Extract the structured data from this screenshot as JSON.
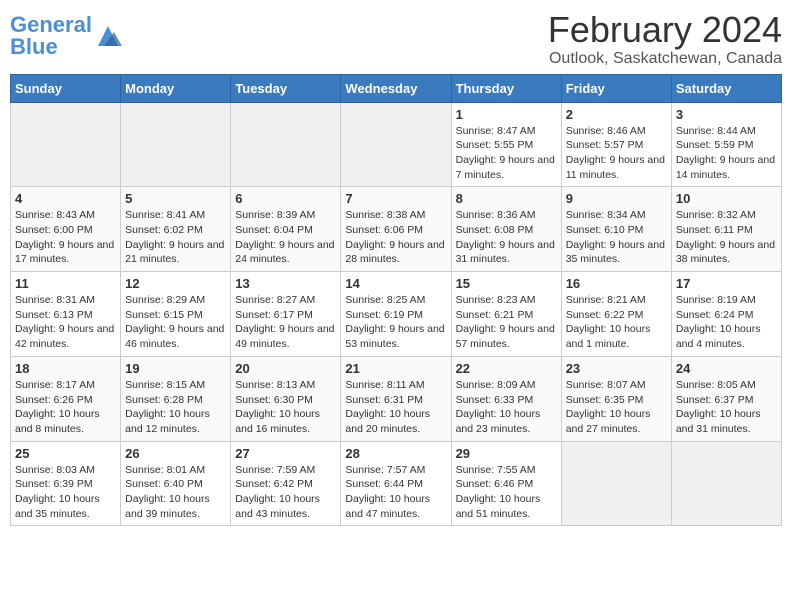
{
  "header": {
    "logo_general": "General",
    "logo_blue": "Blue",
    "title": "February 2024",
    "subtitle": "Outlook, Saskatchewan, Canada"
  },
  "weekdays": [
    "Sunday",
    "Monday",
    "Tuesday",
    "Wednesday",
    "Thursday",
    "Friday",
    "Saturday"
  ],
  "weeks": [
    [
      {
        "day": "",
        "info": ""
      },
      {
        "day": "",
        "info": ""
      },
      {
        "day": "",
        "info": ""
      },
      {
        "day": "",
        "info": ""
      },
      {
        "day": "1",
        "info": "Sunrise: 8:47 AM\nSunset: 5:55 PM\nDaylight: 9 hours and 7 minutes."
      },
      {
        "day": "2",
        "info": "Sunrise: 8:46 AM\nSunset: 5:57 PM\nDaylight: 9 hours and 11 minutes."
      },
      {
        "day": "3",
        "info": "Sunrise: 8:44 AM\nSunset: 5:59 PM\nDaylight: 9 hours and 14 minutes."
      }
    ],
    [
      {
        "day": "4",
        "info": "Sunrise: 8:43 AM\nSunset: 6:00 PM\nDaylight: 9 hours and 17 minutes."
      },
      {
        "day": "5",
        "info": "Sunrise: 8:41 AM\nSunset: 6:02 PM\nDaylight: 9 hours and 21 minutes."
      },
      {
        "day": "6",
        "info": "Sunrise: 8:39 AM\nSunset: 6:04 PM\nDaylight: 9 hours and 24 minutes."
      },
      {
        "day": "7",
        "info": "Sunrise: 8:38 AM\nSunset: 6:06 PM\nDaylight: 9 hours and 28 minutes."
      },
      {
        "day": "8",
        "info": "Sunrise: 8:36 AM\nSunset: 6:08 PM\nDaylight: 9 hours and 31 minutes."
      },
      {
        "day": "9",
        "info": "Sunrise: 8:34 AM\nSunset: 6:10 PM\nDaylight: 9 hours and 35 minutes."
      },
      {
        "day": "10",
        "info": "Sunrise: 8:32 AM\nSunset: 6:11 PM\nDaylight: 9 hours and 38 minutes."
      }
    ],
    [
      {
        "day": "11",
        "info": "Sunrise: 8:31 AM\nSunset: 6:13 PM\nDaylight: 9 hours and 42 minutes."
      },
      {
        "day": "12",
        "info": "Sunrise: 8:29 AM\nSunset: 6:15 PM\nDaylight: 9 hours and 46 minutes."
      },
      {
        "day": "13",
        "info": "Sunrise: 8:27 AM\nSunset: 6:17 PM\nDaylight: 9 hours and 49 minutes."
      },
      {
        "day": "14",
        "info": "Sunrise: 8:25 AM\nSunset: 6:19 PM\nDaylight: 9 hours and 53 minutes."
      },
      {
        "day": "15",
        "info": "Sunrise: 8:23 AM\nSunset: 6:21 PM\nDaylight: 9 hours and 57 minutes."
      },
      {
        "day": "16",
        "info": "Sunrise: 8:21 AM\nSunset: 6:22 PM\nDaylight: 10 hours and 1 minute."
      },
      {
        "day": "17",
        "info": "Sunrise: 8:19 AM\nSunset: 6:24 PM\nDaylight: 10 hours and 4 minutes."
      }
    ],
    [
      {
        "day": "18",
        "info": "Sunrise: 8:17 AM\nSunset: 6:26 PM\nDaylight: 10 hours and 8 minutes."
      },
      {
        "day": "19",
        "info": "Sunrise: 8:15 AM\nSunset: 6:28 PM\nDaylight: 10 hours and 12 minutes."
      },
      {
        "day": "20",
        "info": "Sunrise: 8:13 AM\nSunset: 6:30 PM\nDaylight: 10 hours and 16 minutes."
      },
      {
        "day": "21",
        "info": "Sunrise: 8:11 AM\nSunset: 6:31 PM\nDaylight: 10 hours and 20 minutes."
      },
      {
        "day": "22",
        "info": "Sunrise: 8:09 AM\nSunset: 6:33 PM\nDaylight: 10 hours and 23 minutes."
      },
      {
        "day": "23",
        "info": "Sunrise: 8:07 AM\nSunset: 6:35 PM\nDaylight: 10 hours and 27 minutes."
      },
      {
        "day": "24",
        "info": "Sunrise: 8:05 AM\nSunset: 6:37 PM\nDaylight: 10 hours and 31 minutes."
      }
    ],
    [
      {
        "day": "25",
        "info": "Sunrise: 8:03 AM\nSunset: 6:39 PM\nDaylight: 10 hours and 35 minutes."
      },
      {
        "day": "26",
        "info": "Sunrise: 8:01 AM\nSunset: 6:40 PM\nDaylight: 10 hours and 39 minutes."
      },
      {
        "day": "27",
        "info": "Sunrise: 7:59 AM\nSunset: 6:42 PM\nDaylight: 10 hours and 43 minutes."
      },
      {
        "day": "28",
        "info": "Sunrise: 7:57 AM\nSunset: 6:44 PM\nDaylight: 10 hours and 47 minutes."
      },
      {
        "day": "29",
        "info": "Sunrise: 7:55 AM\nSunset: 6:46 PM\nDaylight: 10 hours and 51 minutes."
      },
      {
        "day": "",
        "info": ""
      },
      {
        "day": "",
        "info": ""
      }
    ]
  ]
}
